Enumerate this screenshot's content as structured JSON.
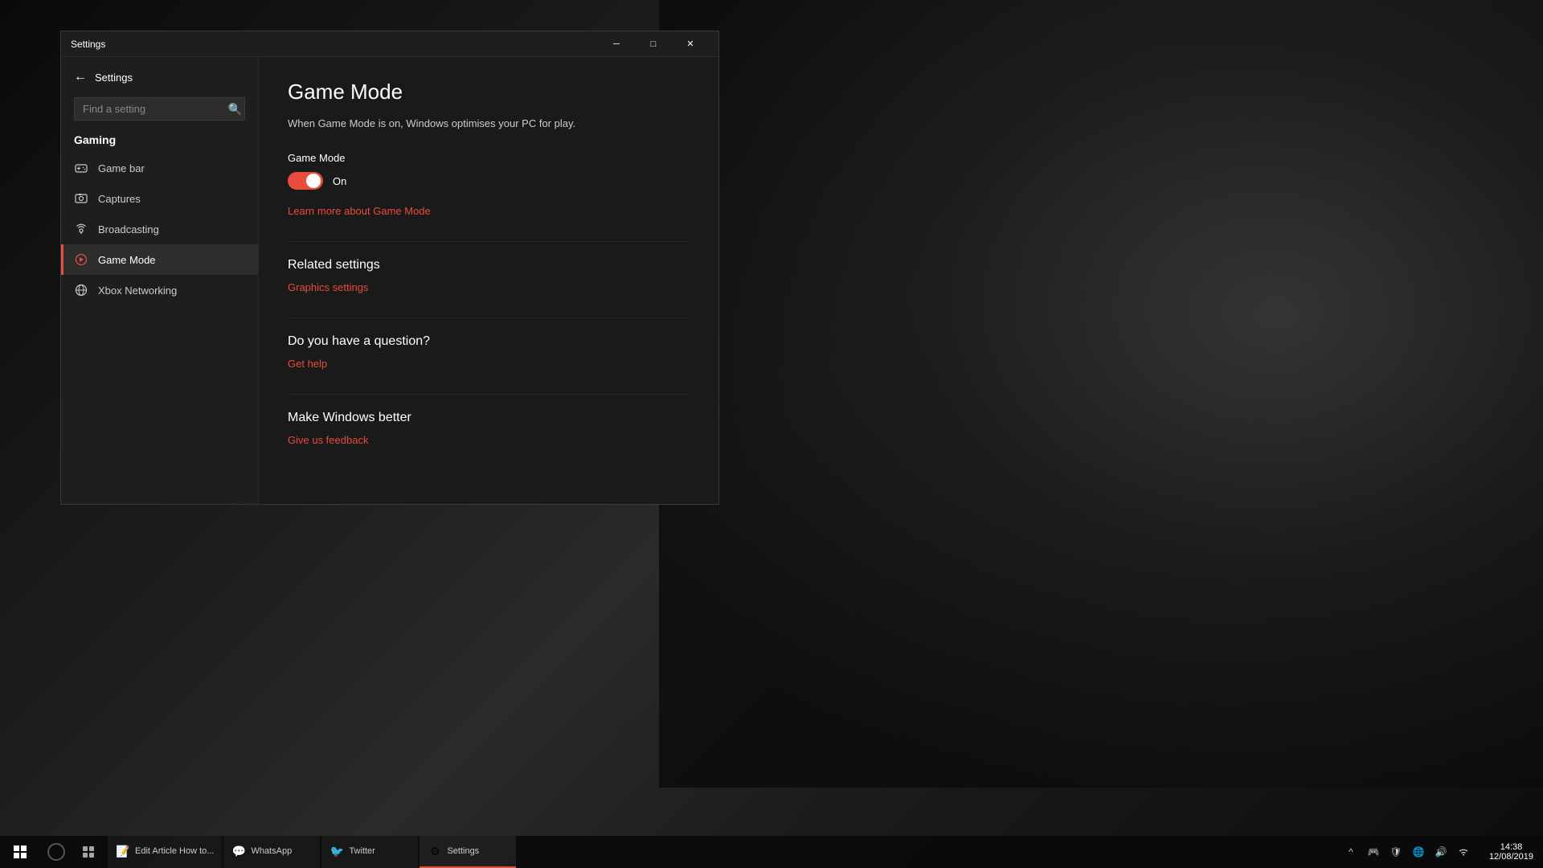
{
  "desktop": {
    "bg_description": "Fallout power armor dark grayscale wallpaper"
  },
  "window": {
    "title": "Settings",
    "title_bar": {
      "minimize": "─",
      "maximize": "□",
      "close": "✕"
    }
  },
  "sidebar": {
    "back_label": "Settings",
    "search_placeholder": "Find a setting",
    "section_label": "Gaming",
    "nav_items": [
      {
        "id": "game-bar",
        "label": "Game bar",
        "icon": "🎮"
      },
      {
        "id": "captures",
        "label": "Captures",
        "icon": "📷"
      },
      {
        "id": "broadcasting",
        "label": "Broadcasting",
        "icon": "📡"
      },
      {
        "id": "game-mode",
        "label": "Game Mode",
        "icon": "🎮",
        "active": true
      },
      {
        "id": "xbox-networking",
        "label": "Xbox Networking",
        "icon": "🌐"
      }
    ]
  },
  "main": {
    "page_title": "Game Mode",
    "subtitle": "When Game Mode is on, Windows optimises your PC for play.",
    "game_mode_section": {
      "label": "Game Mode",
      "toggle_state": "on",
      "toggle_label": "On",
      "learn_more_link": "Learn more about Game Mode"
    },
    "related_settings": {
      "title": "Related settings",
      "graphics_link": "Graphics settings"
    },
    "question": {
      "title": "Do you have a question?",
      "help_link": "Get help"
    },
    "feedback": {
      "title": "Make Windows better",
      "feedback_link": "Give us feedback"
    }
  },
  "taskbar": {
    "apps": [
      {
        "id": "edit-article",
        "label": "Edit Article How to...",
        "icon": "📝",
        "active": false
      },
      {
        "id": "whatsapp",
        "label": "WhatsApp",
        "icon": "💬",
        "active": false
      },
      {
        "id": "twitter",
        "label": "Twitter",
        "icon": "🐦",
        "active": false
      },
      {
        "id": "settings",
        "label": "Settings",
        "icon": "⚙",
        "active": true
      }
    ],
    "clock": {
      "time": "14:38",
      "date": "12/08/2019"
    },
    "tray_icons": [
      "^",
      "🎮",
      "🔒",
      "🌐",
      "🔊",
      "📶"
    ]
  },
  "colors": {
    "accent": "#e74c3c",
    "active_border": "#e74c3c",
    "toggle_on": "#e74c3c",
    "link": "#e74c3c"
  }
}
